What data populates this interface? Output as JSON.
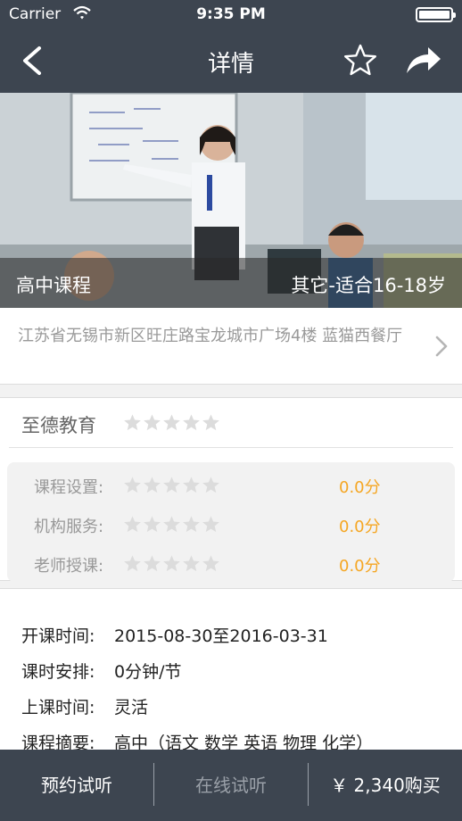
{
  "status_bar": {
    "carrier": "Carrier",
    "time": "9:35 PM"
  },
  "nav": {
    "title": "详情",
    "back_icon": "chevron-left-icon",
    "favorite_icon": "star-outline-icon",
    "share_icon": "share-arrow-icon"
  },
  "hero": {
    "category": "高中课程",
    "age_range": "其它-适合16-18岁"
  },
  "address": {
    "text": "江苏省无锡市新区旺庄路宝龙城市广场4楼 蓝猫西餐厅"
  },
  "organization": {
    "name": "至德教育",
    "rating_stars": 0
  },
  "ratings": [
    {
      "label": "课程设置:",
      "stars": 0,
      "score": "0.0分"
    },
    {
      "label": "机构服务:",
      "stars": 0,
      "score": "0.0分"
    },
    {
      "label": "老师授课:",
      "stars": 0,
      "score": "0.0分"
    }
  ],
  "details": [
    {
      "key": "开课时间:",
      "value": "2015-08-30至2016-03-31"
    },
    {
      "key": "课时安排:",
      "value": "0分钟/节"
    },
    {
      "key": "上课时间:",
      "value": "灵活"
    },
    {
      "key": "课程摘要:",
      "value": "高中（语文 数学 英语 物理 化学）"
    }
  ],
  "bottom_bar": {
    "book_trial": "预约试听",
    "online_trial": "在线试听",
    "buy": "￥ 2,340购买"
  },
  "colors": {
    "header": "#3d4550",
    "score": "#f5a623",
    "star_empty": "#dcdcdc"
  }
}
